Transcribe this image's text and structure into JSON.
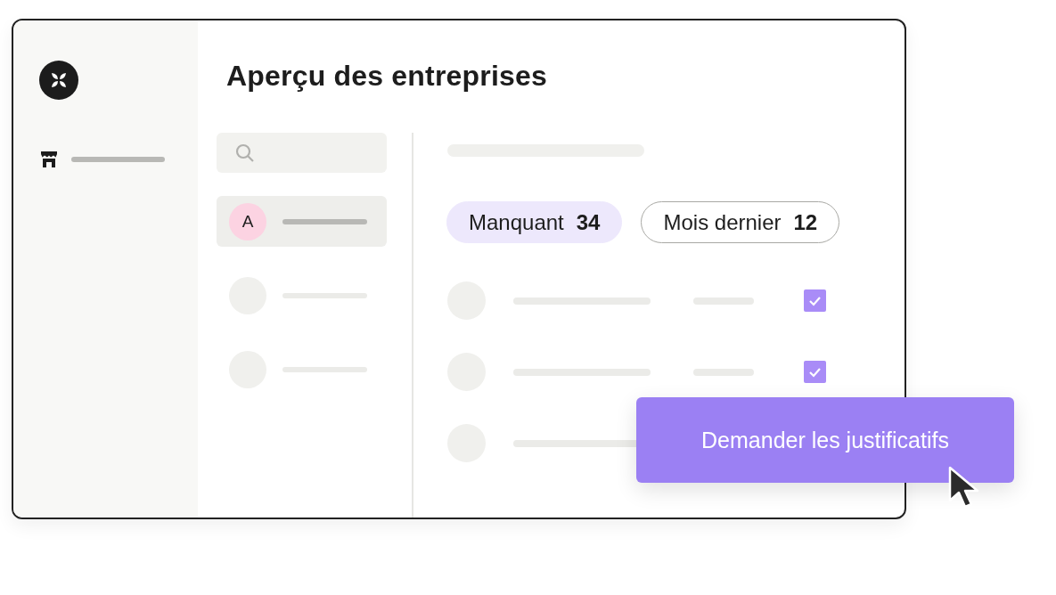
{
  "title": "Aperçu des entreprises",
  "sidebar": {
    "items": [
      {
        "selected": false
      }
    ]
  },
  "companies": [
    {
      "avatar": "A",
      "selected": true
    },
    {
      "selected": false
    },
    {
      "selected": false
    }
  ],
  "filters": [
    {
      "label": "Manquant",
      "count": "34",
      "selected": true
    },
    {
      "label": "Mois dernier",
      "count": "12",
      "selected": false
    }
  ],
  "rows": [
    {
      "checked": true
    },
    {
      "checked": true
    },
    {}
  ],
  "action_button": {
    "label": "Demander les justificatifs"
  }
}
